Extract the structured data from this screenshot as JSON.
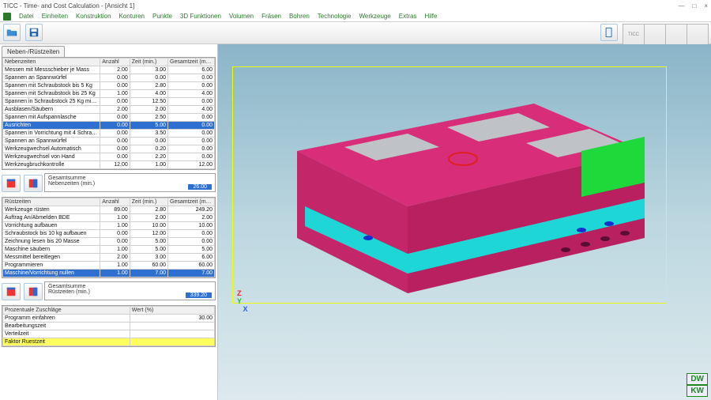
{
  "window": {
    "title": "TICC - Time- and Cost Calculation - [Ansicht 1]",
    "min": "—",
    "max": "□",
    "close": "×"
  },
  "menu": [
    "Datei",
    "Einheiten",
    "Konstruktion",
    "Konturen",
    "Punkte",
    "3D Funktionen",
    "Volumen",
    "Fräsen",
    "Bohren",
    "Technologie",
    "Werkzeuge",
    "Extras",
    "Hilfe"
  ],
  "ribbon": [
    "TICC",
    "",
    "",
    ""
  ],
  "tab_label": "Neben-/Rüstzeiten",
  "nebenzeiten": {
    "headers": [
      "Nebenzeiten",
      "Anzahl",
      "Zeit (min.)",
      "Gesamtzeit (min.)"
    ],
    "rows": [
      {
        "n": "Messen mit Messschieber je Mass",
        "a": "2.00",
        "z": "3.00",
        "g": "6.00"
      },
      {
        "n": "Spannen an Spannwürfel",
        "a": "0.00",
        "z": "0.00",
        "g": "0.00"
      },
      {
        "n": "Spannen mit Schraubstock bis 5 Kg",
        "a": "0.00",
        "z": "2.80",
        "g": "0.00"
      },
      {
        "n": "Spannen mit Schraubstock bis 25 Kg",
        "a": "1.00",
        "z": "4.00",
        "g": "4.00"
      },
      {
        "n": "Spannen in Schraubstock  25 Kg mit Kran",
        "a": "0.00",
        "z": "12.50",
        "g": "0.00"
      },
      {
        "n": "Ausblasen/Säubern",
        "a": "2.00",
        "z": "2.00",
        "g": "4.00"
      },
      {
        "n": "Spannen mit Aufspannlasche",
        "a": "0.00",
        "z": "2.50",
        "g": "0.00"
      },
      {
        "n": "Ausrichten",
        "a": "0.00",
        "z": "5.00",
        "g": "0.00",
        "sel": true
      },
      {
        "n": "Spannen in Vorrichtung mit 4 Schrauben",
        "a": "0.00",
        "z": "3.50",
        "g": "0.00"
      },
      {
        "n": "Spannen an Spannwürfel",
        "a": "0.00",
        "z": "0.00",
        "g": "0.00"
      },
      {
        "n": "Werkzeugwechsel Automatisch",
        "a": "0.00",
        "z": "0.20",
        "g": "0.00"
      },
      {
        "n": "Werkzeugwechsel von Hand",
        "a": "0.00",
        "z": "2.20",
        "g": "0.00"
      },
      {
        "n": "Werkzeugbruchkontrolle",
        "a": "12.00",
        "z": "1.00",
        "g": "12.00"
      }
    ],
    "sum_label1": "Gesamtsumme",
    "sum_label2": "Nebenzeiten (min.)",
    "sum_value": "26.00"
  },
  "ruestzeiten": {
    "headers": [
      "Rüstzeiten",
      "Anzahl",
      "Zeit (min.)",
      "Gesamtzeit (min.)"
    ],
    "rows": [
      {
        "n": "Werkzeuge rüsten",
        "a": "89.00",
        "z": "2.80",
        "g": "249.20"
      },
      {
        "n": "Auftrag An/Abmelden BDE",
        "a": "1.00",
        "z": "2.00",
        "g": "2.00"
      },
      {
        "n": "Vorrichtung aufbauen",
        "a": "1.00",
        "z": "10.00",
        "g": "10.00"
      },
      {
        "n": "Schraubstock bis 10 kg aufbauen",
        "a": "0.00",
        "z": "12.00",
        "g": "0.00"
      },
      {
        "n": "Zeichnung lesen bis 20 Masse",
        "a": "0.00",
        "z": "5.00",
        "g": "0.00"
      },
      {
        "n": "Maschine säubern",
        "a": "1.00",
        "z": "5.00",
        "g": "5.00"
      },
      {
        "n": "Messmittel bereitlegen",
        "a": "2.00",
        "z": "3.00",
        "g": "6.00"
      },
      {
        "n": "Programmieren",
        "a": "1.00",
        "z": "60.00",
        "g": "60.00"
      },
      {
        "n": "Maschine/Vorrichtung nullen",
        "a": "1.00",
        "z": "7.00",
        "g": "7.00",
        "sel": true
      }
    ],
    "sum_label1": "Gesamtsumme",
    "sum_label2": "Rüstzeiten (min.)",
    "sum_value": "339.20"
  },
  "zuschlaege": {
    "headers": [
      "Prozentuale Zuschläge",
      "Wert (%)"
    ],
    "rows": [
      {
        "n": "Programm einfahren",
        "w": "30.00"
      },
      {
        "n": "Bearbeitungszeit",
        "w": ""
      },
      {
        "n": "Verteilzeit",
        "w": ""
      },
      {
        "n": "Faktor Ruestzeit",
        "w": "",
        "sel": true
      }
    ]
  },
  "viewer_badges": [
    "DW",
    "KW"
  ],
  "axes": {
    "z": "Z",
    "y": "Y",
    "x": "X"
  }
}
